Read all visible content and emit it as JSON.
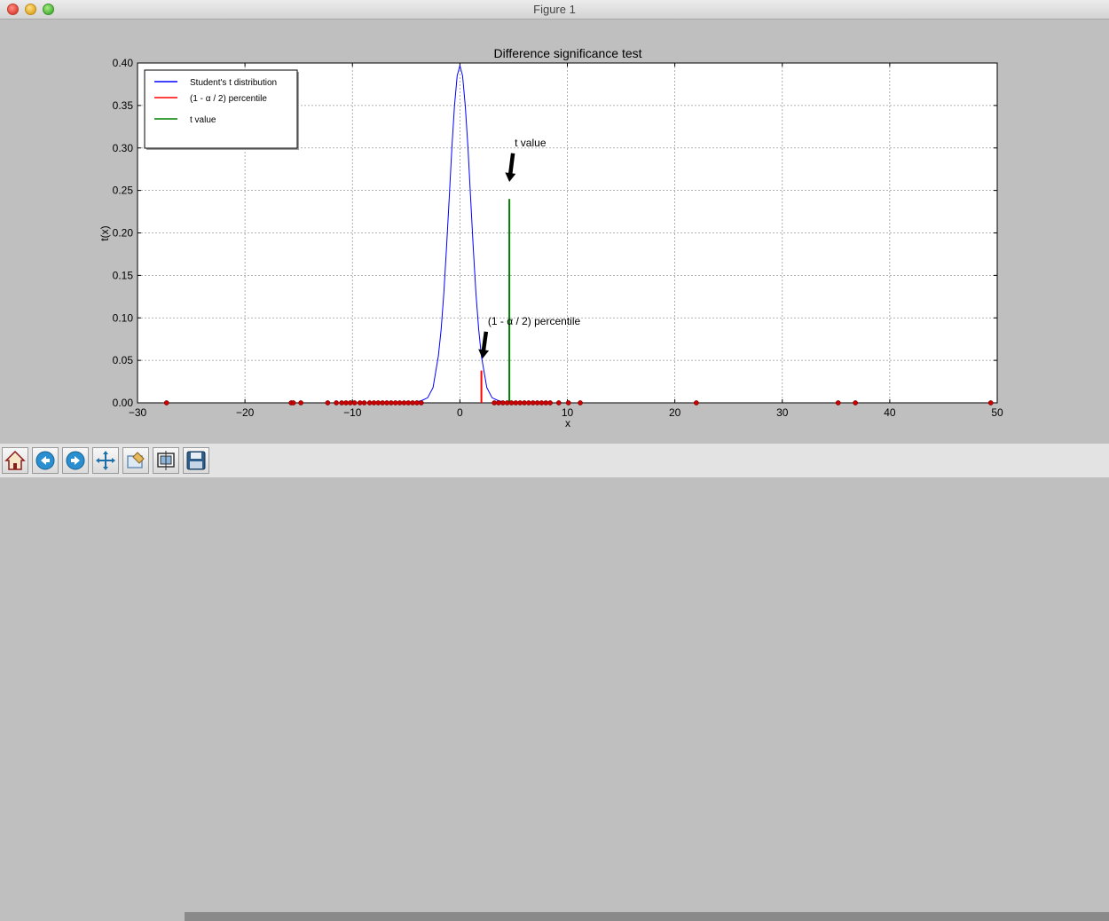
{
  "window": {
    "title": "Figure 1"
  },
  "chart_data": {
    "type": "line",
    "title": "Difference significance test",
    "xlabel": "x",
    "ylabel": "t(x)",
    "xlim": [
      -30,
      50
    ],
    "ylim": [
      0,
      0.4
    ],
    "xticks": [
      -30,
      -20,
      -10,
      0,
      10,
      20,
      30,
      40,
      50
    ],
    "xtick_labels": [
      "−30",
      "−20",
      "−10",
      "0",
      "10",
      "20",
      "30",
      "40",
      "50"
    ],
    "yticks": [
      0,
      0.05,
      0.1,
      0.15,
      0.2,
      0.25,
      0.3,
      0.35,
      0.4
    ],
    "ytick_labels": [
      "0.00",
      "0.05",
      "0.10",
      "0.15",
      "0.20",
      "0.25",
      "0.30",
      "0.35",
      "0.40"
    ],
    "grid": true,
    "legend_position": "top-left",
    "series": [
      {
        "name": "Student's t distribution",
        "kind": "curve",
        "color": "#0000ff",
        "x": [
          -4,
          -3.5,
          -3,
          -2.5,
          -2,
          -1.75,
          -1.5,
          -1.25,
          -1,
          -0.75,
          -0.5,
          -0.25,
          0,
          0.25,
          0.5,
          0.75,
          1,
          1.25,
          1.5,
          1.75,
          2,
          2.5,
          3,
          3.5,
          4
        ],
        "y": [
          0.001,
          0.003,
          0.006,
          0.018,
          0.055,
          0.086,
          0.128,
          0.181,
          0.24,
          0.3,
          0.35,
          0.385,
          0.397,
          0.385,
          0.35,
          0.3,
          0.24,
          0.181,
          0.128,
          0.086,
          0.055,
          0.018,
          0.006,
          0.003,
          0.001
        ]
      },
      {
        "name": "(1 - α / 2) percentile",
        "kind": "vline",
        "color": "#ff0000",
        "x": 2.0,
        "y": 0.038
      },
      {
        "name": "t value",
        "kind": "vline",
        "color": "#008000",
        "x": 4.6,
        "y": 0.24
      },
      {
        "name": "",
        "kind": "points",
        "color": "#cc0000",
        "x": [
          -27.3,
          -15.7,
          -15.5,
          -14.8,
          -12.3,
          -11.5,
          -11.0,
          -10.6,
          -10.2,
          -9.8,
          -9.3,
          -8.9,
          -8.4,
          -8.0,
          -7.6,
          -7.2,
          -6.8,
          -6.4,
          -6.0,
          -5.6,
          -5.2,
          -4.8,
          -4.4,
          -4.0,
          -3.6,
          3.2,
          3.6,
          4.0,
          4.4,
          4.8,
          5.2,
          5.6,
          6.0,
          6.4,
          6.8,
          7.2,
          7.6,
          8.0,
          8.4,
          9.2,
          10.1,
          11.2,
          22.0,
          35.2,
          36.8,
          49.4
        ],
        "y": 0
      }
    ],
    "annotations": [
      {
        "text": "t value",
        "x": 5.1,
        "y": 0.3,
        "arrow_to_x": 4.6,
        "arrow_to_y": 0.26
      },
      {
        "text": "(1 - α / 2) percentile",
        "x": 2.6,
        "y": 0.09,
        "arrow_to_x": 2.1,
        "arrow_to_y": 0.052
      }
    ]
  },
  "toolbar": {
    "buttons": [
      {
        "name": "home-button",
        "icon": "home-icon"
      },
      {
        "name": "back-button",
        "icon": "back-arrow-icon"
      },
      {
        "name": "forward-button",
        "icon": "forward-arrow-icon"
      },
      {
        "name": "pan-button",
        "icon": "pan-arrows-icon"
      },
      {
        "name": "zoom-button",
        "icon": "zoom-rect-icon"
      },
      {
        "name": "subplots-button",
        "icon": "subplots-icon"
      },
      {
        "name": "save-button",
        "icon": "floppy-disk-icon"
      }
    ]
  }
}
